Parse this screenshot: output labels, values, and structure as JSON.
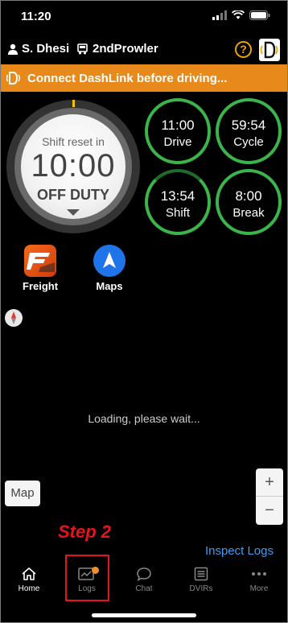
{
  "status_bar": {
    "time": "11:20"
  },
  "header": {
    "driver_name": "S. Dhesi",
    "vehicle_name": "2ndProwler",
    "help_label": "?"
  },
  "banner": {
    "text": "Connect DashLink before driving..."
  },
  "dial": {
    "caption": "Shift reset in",
    "time": "10:00",
    "status": "OFF DUTY"
  },
  "clocks": [
    {
      "value": "11:00",
      "label": "Drive"
    },
    {
      "value": "59:54",
      "label": "Cycle"
    },
    {
      "value": "13:54",
      "label": "Shift"
    },
    {
      "value": "8:00",
      "label": "Break"
    }
  ],
  "apps": [
    {
      "label": "Freight"
    },
    {
      "label": "Maps"
    }
  ],
  "map": {
    "loading_text": "Loading, please wait...",
    "map_button": "Map",
    "zoom_in": "+",
    "zoom_out": "−"
  },
  "annotation": {
    "step": "Step 2"
  },
  "inspect_logs": "Inspect Logs",
  "tabs": [
    {
      "label": "Home",
      "icon": "home-icon",
      "active": true
    },
    {
      "label": "Logs",
      "icon": "logs-icon",
      "active": false
    },
    {
      "label": "Chat",
      "icon": "chat-icon",
      "active": false
    },
    {
      "label": "DVIRs",
      "icon": "dvirs-icon",
      "active": false
    },
    {
      "label": "More",
      "icon": "more-icon",
      "active": false
    }
  ],
  "colors": {
    "banner": "#e8891c",
    "ring_green": "#3bb54a",
    "accent_blue": "#3f9bf0",
    "annotation_red": "#e6121d",
    "badge_orange": "#f0902a"
  }
}
